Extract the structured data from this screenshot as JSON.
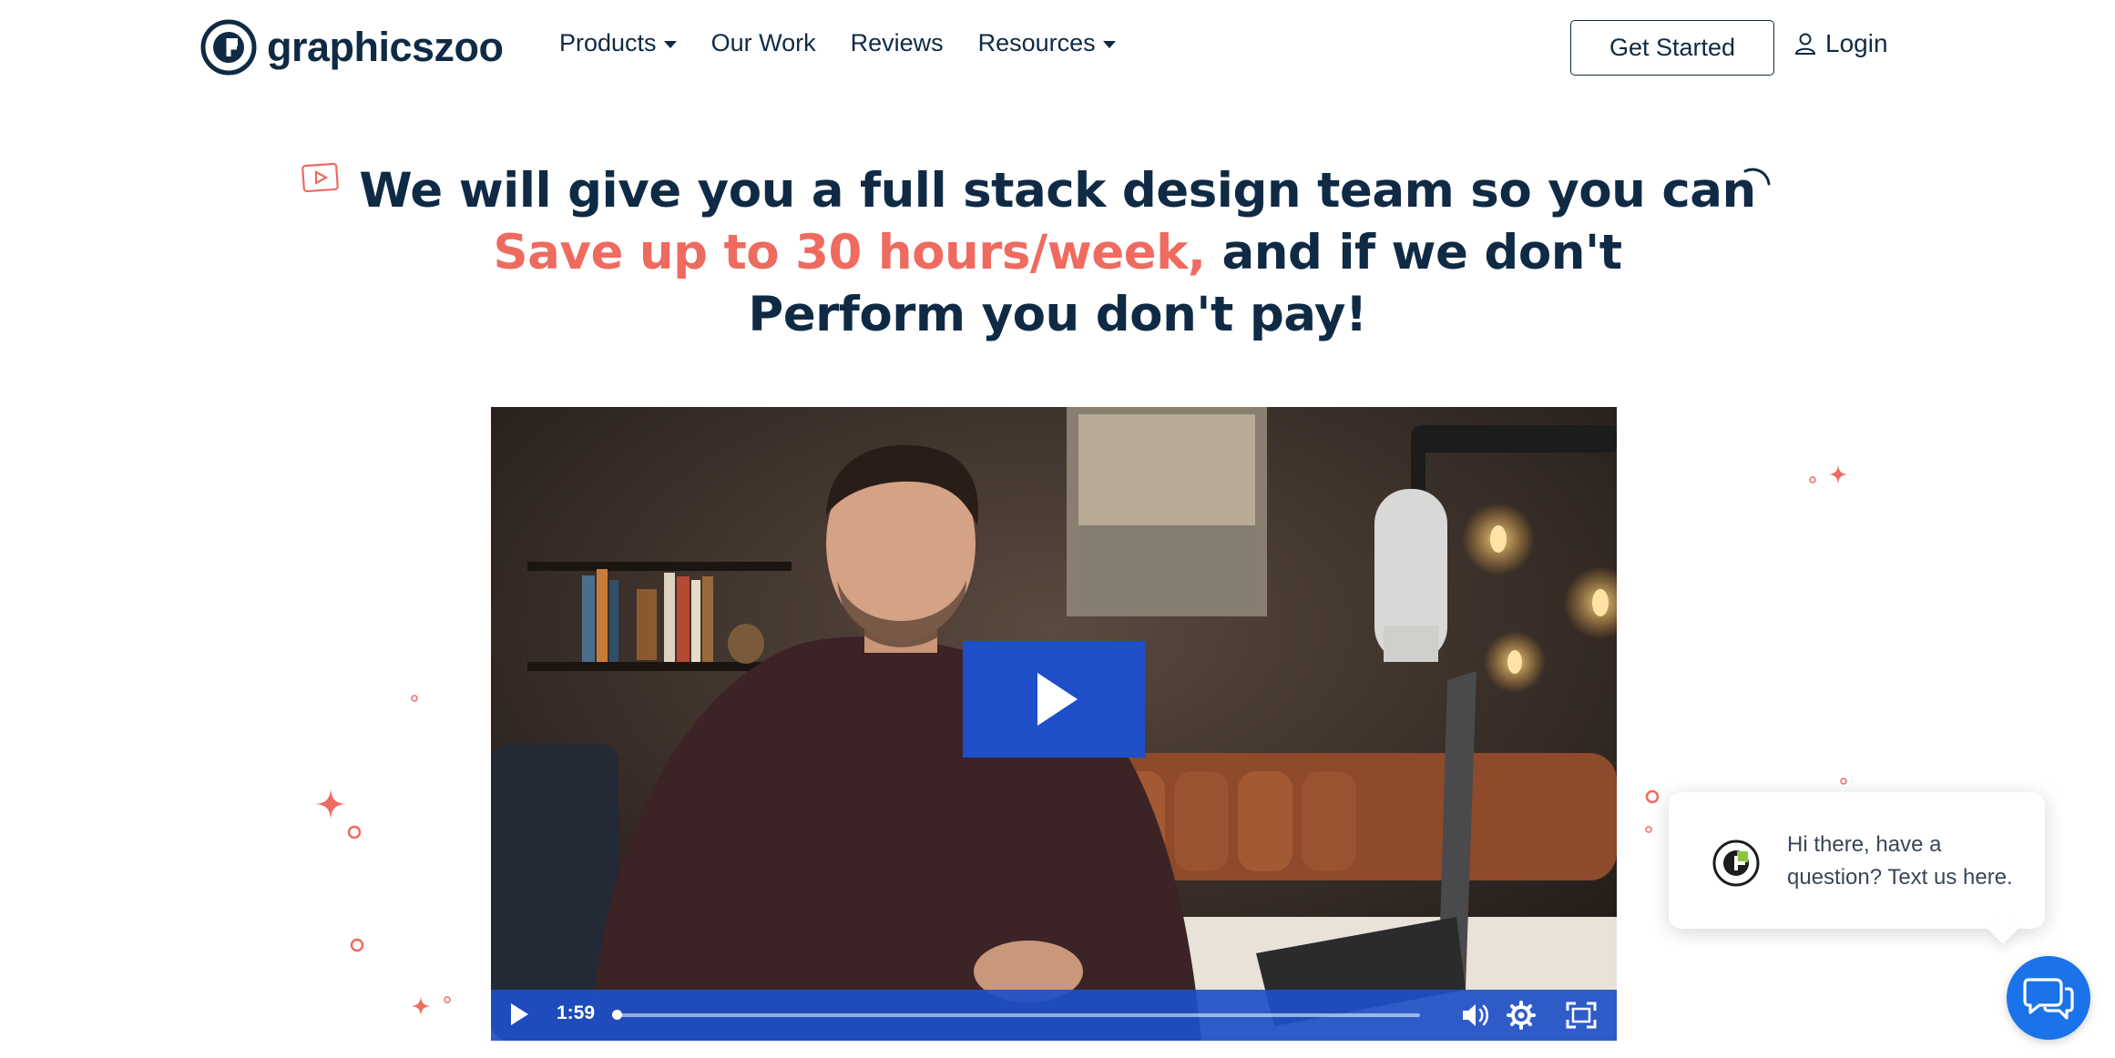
{
  "nav": {
    "logo_text": "graphicszoo",
    "links": [
      {
        "label": "Products",
        "has_caret": true
      },
      {
        "label": "Our Work",
        "has_caret": false
      },
      {
        "label": "Reviews",
        "has_caret": false
      },
      {
        "label": "Resources",
        "has_caret": true
      }
    ],
    "cta_label": "Get Started",
    "login_label": "Login"
  },
  "hero": {
    "line1": "We will give you a full stack design team so you can",
    "line2_accent": "Save up to 30 hours/week,",
    "line2_rest": " and if we don't",
    "line3": "Perform you don't pay!"
  },
  "video": {
    "time": "1:59",
    "progress": 0.0,
    "icons": [
      "play-icon",
      "volume-icon",
      "settings-icon",
      "fullscreen-icon"
    ]
  },
  "chat": {
    "message": "Hi there, have a question? Text us here."
  },
  "colors": {
    "navy": "#0f2a44",
    "accent": "#ef6a5f",
    "video_blue": "#1e4fc8",
    "chat_blue": "#1a73e8"
  }
}
